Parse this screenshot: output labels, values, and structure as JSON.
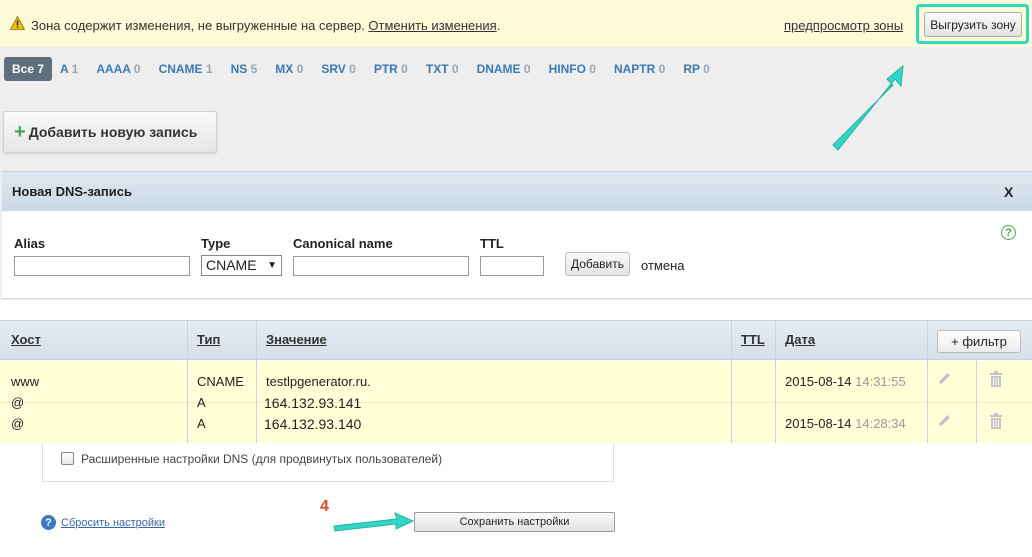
{
  "banner": {
    "message": "Зона содержит изменения, не выгруженные на сервер.",
    "revert_link": "Отменить изменения",
    "trailing": ".",
    "preview_link": "предпросмотр зоны",
    "upload_button": "Выгрузить зону"
  },
  "tabs": [
    {
      "label": "Все",
      "count": "7"
    },
    {
      "label": "A",
      "count": "1"
    },
    {
      "label": "AAAA",
      "count": "0"
    },
    {
      "label": "CNAME",
      "count": "1"
    },
    {
      "label": "NS",
      "count": "5"
    },
    {
      "label": "MX",
      "count": "0"
    },
    {
      "label": "SRV",
      "count": "0"
    },
    {
      "label": "PTR",
      "count": "0"
    },
    {
      "label": "TXT",
      "count": "0"
    },
    {
      "label": "DNAME",
      "count": "0"
    },
    {
      "label": "HINFO",
      "count": "0"
    },
    {
      "label": "NAPTR",
      "count": "0"
    },
    {
      "label": "RP",
      "count": "0"
    }
  ],
  "add_record_button": "Добавить новую запись",
  "new_record": {
    "title": "Новая DNS-запись",
    "close": "X",
    "alias_label": "Alias",
    "type_label": "Type",
    "type_value": "CNAME",
    "type_arrow": "▼",
    "canonical_label": "Canonical name",
    "ttl_label": "TTL",
    "add_button": "Добавить",
    "cancel": "отмена",
    "help": "?"
  },
  "table": {
    "headers": {
      "host": "Хост",
      "type": "Тип",
      "value": "Значение",
      "ttl": "TTL",
      "date": "Дата"
    },
    "filter_button": "+ фильтр",
    "rows": [
      {
        "host": "www",
        "type": "CNAME",
        "value": "testlpgenerator.ru.",
        "date": "2015-08-14",
        "time": "14:31:55"
      },
      {
        "host": "@",
        "type": "A",
        "value": "164.132.93.141",
        "date": "",
        "time": ""
      },
      {
        "host": "@",
        "type": "A",
        "value": "164.132.93.140",
        "date": "2015-08-14",
        "time": "14:28:34"
      }
    ]
  },
  "advanced_dns_label": "Расширенные настройки DNS (для продвинутых пользователей)",
  "reset_link": "Сбросить настройки",
  "save_button": "Сохранить настройки",
  "step_marker": "4",
  "colors": {
    "highlight": "#33d6c3",
    "banner_bg": "#fdfad8",
    "row_bg": "#ffffd8",
    "step": "#e14a1f"
  }
}
